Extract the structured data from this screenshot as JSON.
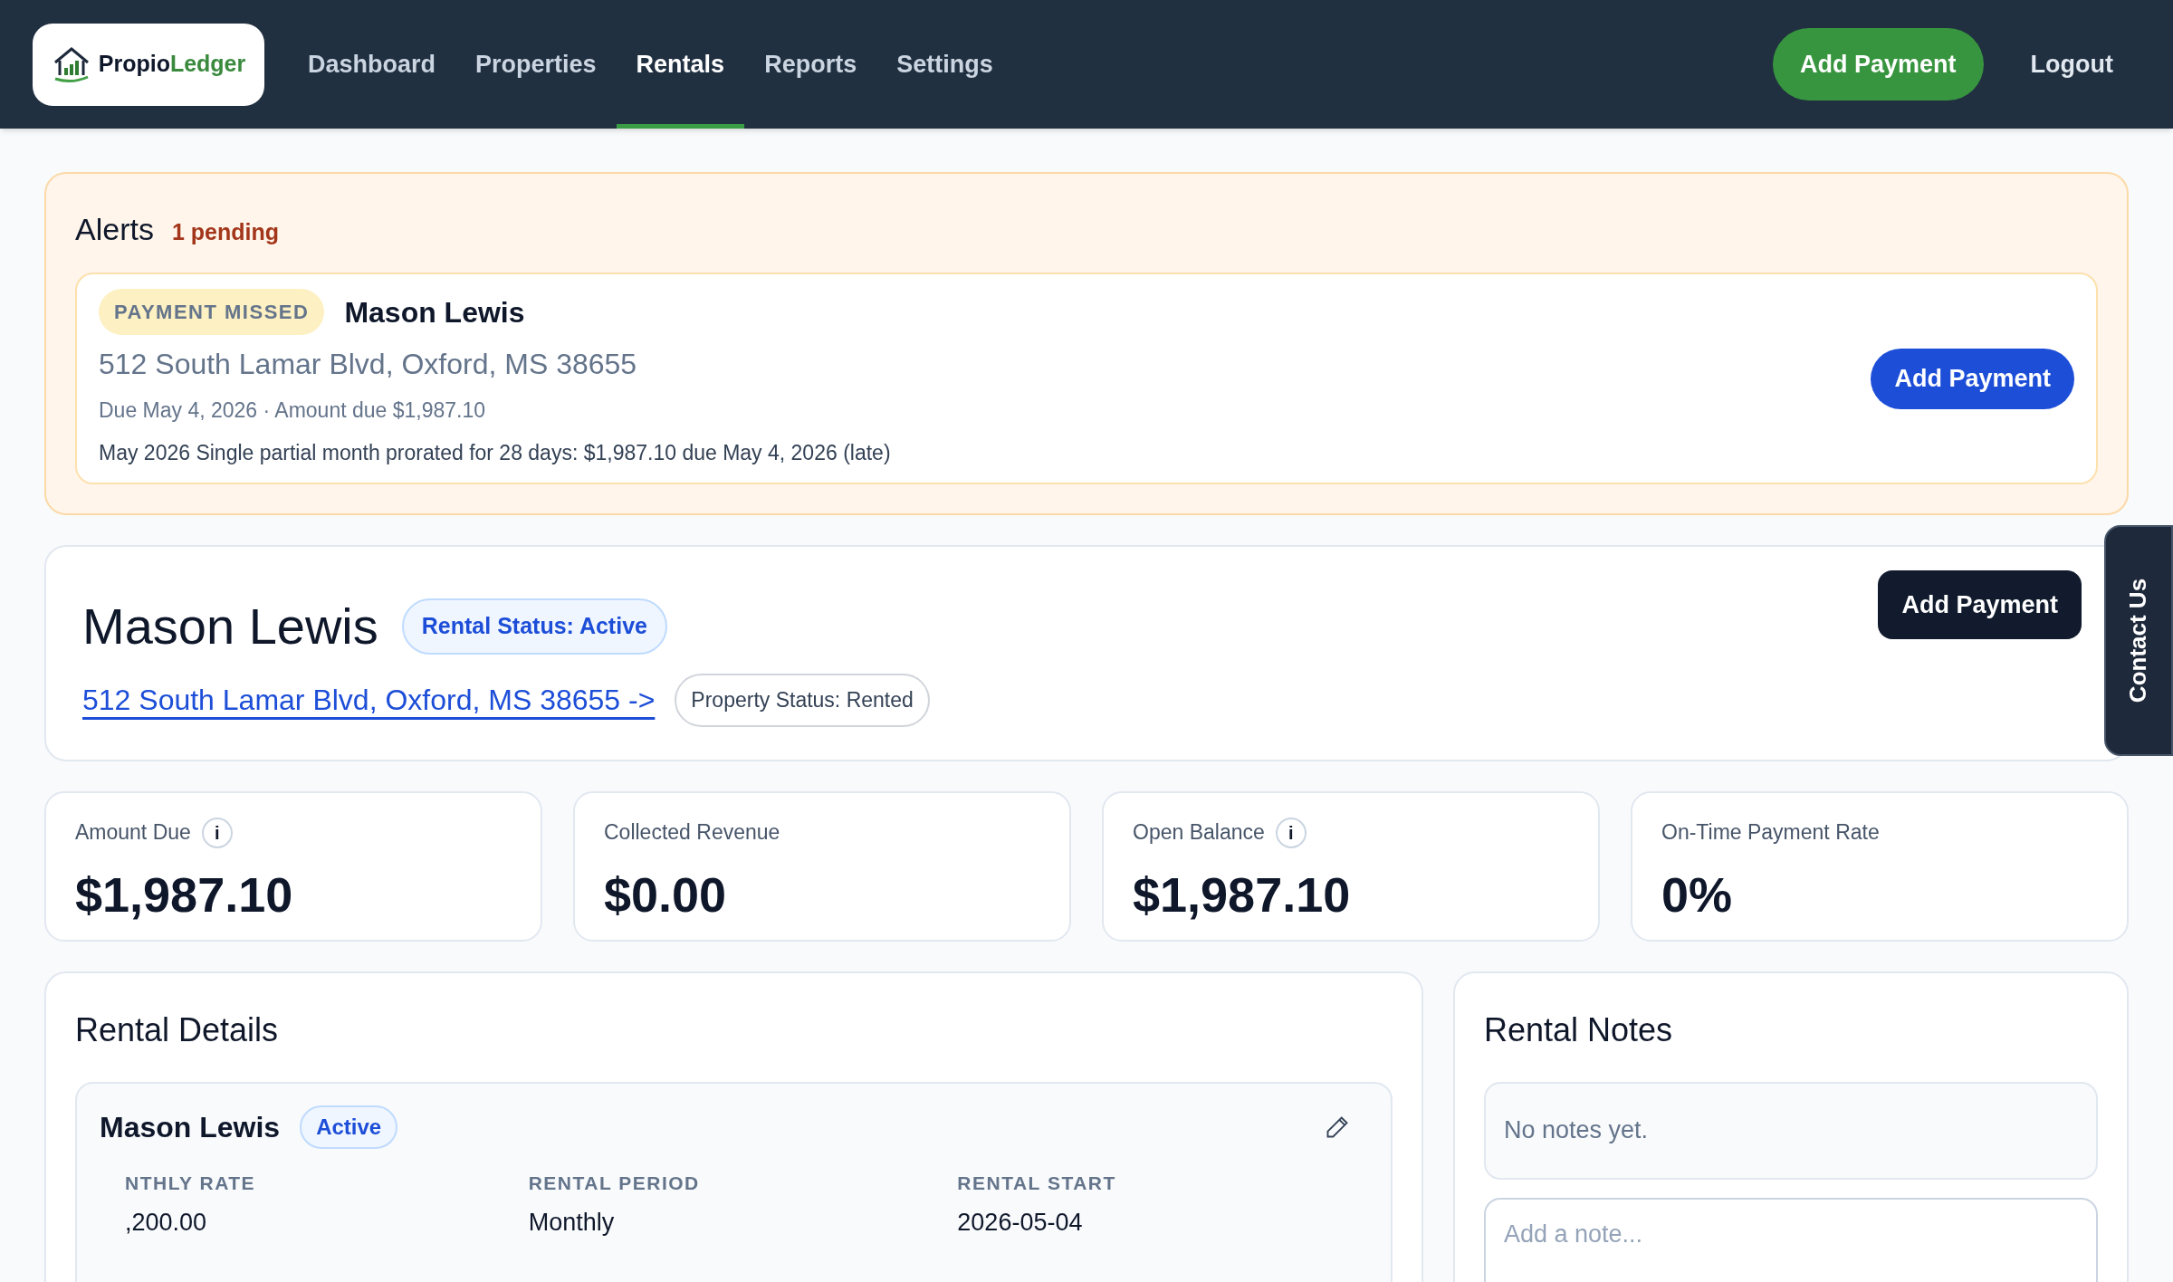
{
  "nav": {
    "logo": {
      "prefix": "Propio",
      "suffix": "Ledger"
    },
    "links": [
      {
        "label": "Dashboard",
        "selected": false
      },
      {
        "label": "Properties",
        "selected": false
      },
      {
        "label": "Rentals",
        "selected": true
      },
      {
        "label": "Reports",
        "selected": false
      },
      {
        "label": "Settings",
        "selected": false
      }
    ],
    "primary_button": "Add Payment",
    "logout": "Logout"
  },
  "alerts": {
    "title": "Alerts",
    "count": "1 pending",
    "items": [
      {
        "badge": "PAYMENT MISSED",
        "name": "Mason Lewis",
        "address": "512 South Lamar Blvd, Oxford, MS 38655",
        "due": "Due May 4, 2026 · Amount due $1,987.10",
        "detail": "May 2026 Single partial month prorated for 28 days: $1,987.10 due May 4, 2026 (late)",
        "button": "Add Payment"
      }
    ]
  },
  "header": {
    "name": "Mason Lewis",
    "status": "Rental Status: Active",
    "address_link": "512 South Lamar Blvd, Oxford, MS 38655 ->",
    "property_status": "Property Status: Rented",
    "button": "Add Payment"
  },
  "contact_tab": "Contact Us",
  "stats": [
    {
      "label": "Amount Due",
      "info": "i",
      "value": "$1,987.10"
    },
    {
      "label": "Collected Revenue",
      "value": "$0.00"
    },
    {
      "label": "Open Balance",
      "info": "i",
      "value": "$1,987.10"
    },
    {
      "label": "On-Time Payment Rate",
      "value": "0%"
    }
  ],
  "details": {
    "title": "Rental Details",
    "name": "Mason Lewis",
    "badge": "Active",
    "fields": [
      {
        "label": "NTHLY RATE",
        "value": ",200.00"
      },
      {
        "label": "RENTAL PERIOD",
        "value": "Monthly"
      },
      {
        "label": "RENTAL START",
        "value": "2026-05-04"
      }
    ]
  },
  "notes": {
    "title": "Rental Notes",
    "empty": "No notes yet.",
    "placeholder": "Add a note..."
  }
}
